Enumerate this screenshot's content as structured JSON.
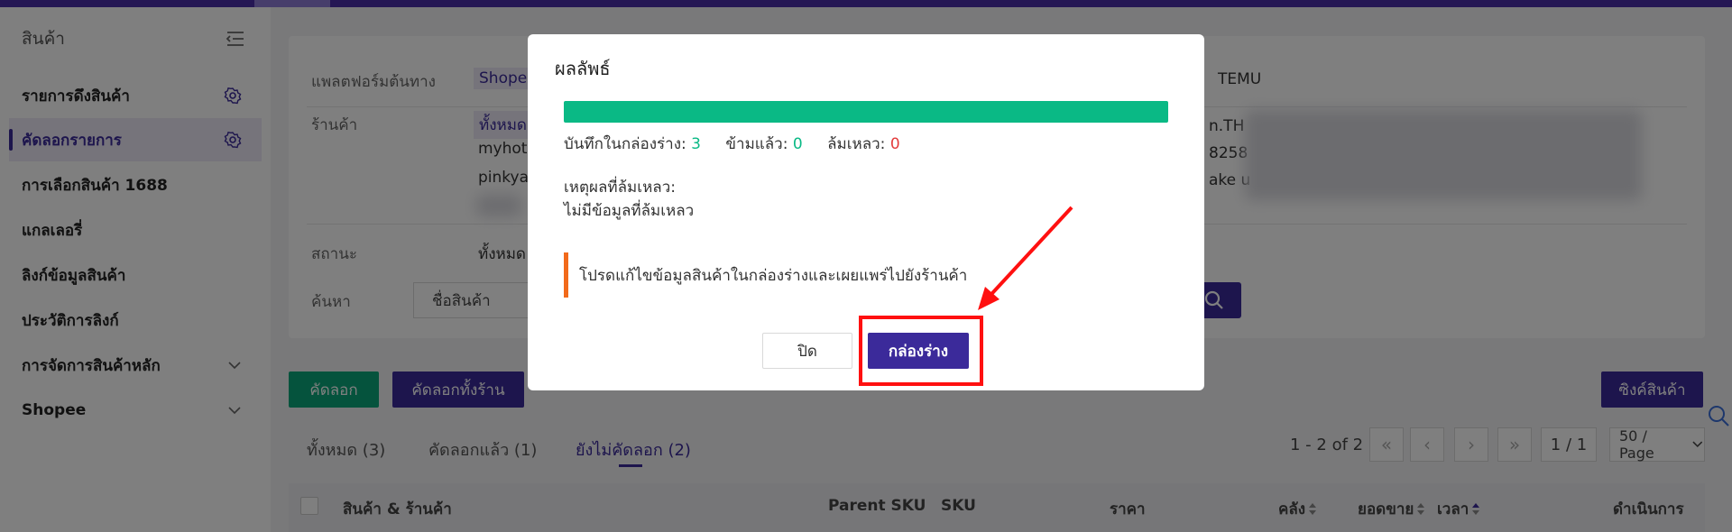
{
  "sidebar": {
    "title": "สินค้า",
    "items": [
      {
        "label": "รายการดึงสินค้า"
      },
      {
        "label": "คัดลอกรายการ"
      },
      {
        "label": "การเลือกสินค้า 1688"
      },
      {
        "label": "แกลเลอรี่"
      },
      {
        "label": "ลิงก์ข้อมูลสินค้า"
      },
      {
        "label": "ประวัติการลิงก์"
      },
      {
        "label": "การจัดการสินค้าหลัก"
      },
      {
        "label": "Shopee"
      }
    ]
  },
  "filters": {
    "platform_label": "แพลตฟอร์มต้นทาง",
    "platform_selected": "Shope",
    "platform_temu": "TEMU",
    "shop_label": "ร้านค้า",
    "shop_all": "ทั้งหมด",
    "shop_1": "myhot",
    "shop_2": "pinkya",
    "shop_right_1": "n.TH",
    "shop_right_2": "8258",
    "shop_right_3": "ake u",
    "status_label": "สถานะ",
    "status_all": "ทั้งหมด",
    "search_label": "ค้นหา",
    "search_value": "ชื่อสินค้า"
  },
  "actions": {
    "copy": "คัดลอก",
    "copy_all": "คัดลอกทั้งร้าน",
    "sync": "ซิงค์สินค้า"
  },
  "tabs": [
    {
      "label": "ทั้งหมด (3)"
    },
    {
      "label": "คัดลอกแล้ว (1)"
    },
    {
      "label": "ยังไม่คัดลอก (2)"
    }
  ],
  "pager": {
    "range": "1 - 2 of 2",
    "page": "1 / 1",
    "size": "50 / Page"
  },
  "table": {
    "headers": [
      "สินค้า & ร้านค้า",
      "Parent SKU",
      "SKU",
      "ราคา",
      "คลัง",
      "ยอดขาย",
      "เวลา",
      "ดำเนินการ"
    ]
  },
  "modal": {
    "title": "ผลลัพธ์",
    "progress_percent": 100,
    "saved_label": "บันทึกในกล่องร่าง:",
    "saved_count": "3",
    "skipped_label": "ข้ามแล้ว:",
    "skipped_count": "0",
    "failed_label": "ล้มเหลว:",
    "failed_count": "0",
    "reason_label": "เหตุผลที่ล้มเหลว:",
    "reason_text": "ไม่มีข้อมูลที่ล้มเหลว",
    "notice": "โปรดแก้ไขข้อมูลสินค้าในกล่องร่างและเผยแพร่ไปยังร้านค้า",
    "close_button": "ปิด",
    "draft_button": "กล่องร่าง"
  },
  "colors": {
    "brand": "#3b2a9a",
    "success": "#0ab985",
    "danger": "#e33c3c",
    "warning": "#f26a1b",
    "annotation": "#ff1010"
  }
}
